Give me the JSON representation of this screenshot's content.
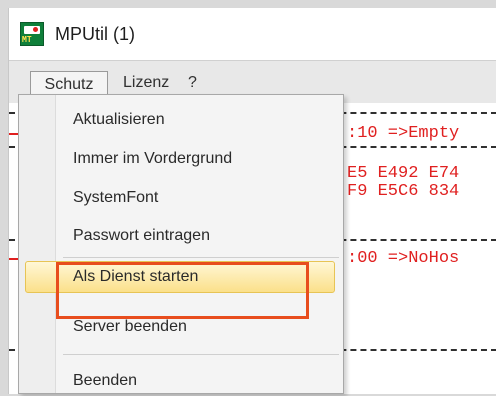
{
  "window": {
    "title": "MPUtil (1)",
    "icon": "mpt-app-icon",
    "icon_text": "MT"
  },
  "menubar": {
    "items": [
      {
        "label": "Schutz"
      },
      {
        "label": "Lizenz"
      },
      {
        "label": "?"
      }
    ]
  },
  "log": {
    "lines": [
      ":10 =>Empty",
      "E5 E492 E74",
      "F9 E5C6 834",
      ":00 =>NoHos"
    ]
  },
  "dropdown": {
    "items": [
      {
        "label": "Aktualisieren"
      },
      {
        "label": "Immer im Vordergrund"
      },
      {
        "label": "SystemFont"
      },
      {
        "label": "Passwort eintragen"
      },
      {
        "label": "Als Dienst starten",
        "highlighted": true
      },
      {
        "label": "Server beenden"
      },
      {
        "label": "Beenden"
      }
    ]
  },
  "colors": {
    "highlight_box": "#e84d1d",
    "log_text": "#e02020",
    "app_icon": "#0f7f3a"
  }
}
